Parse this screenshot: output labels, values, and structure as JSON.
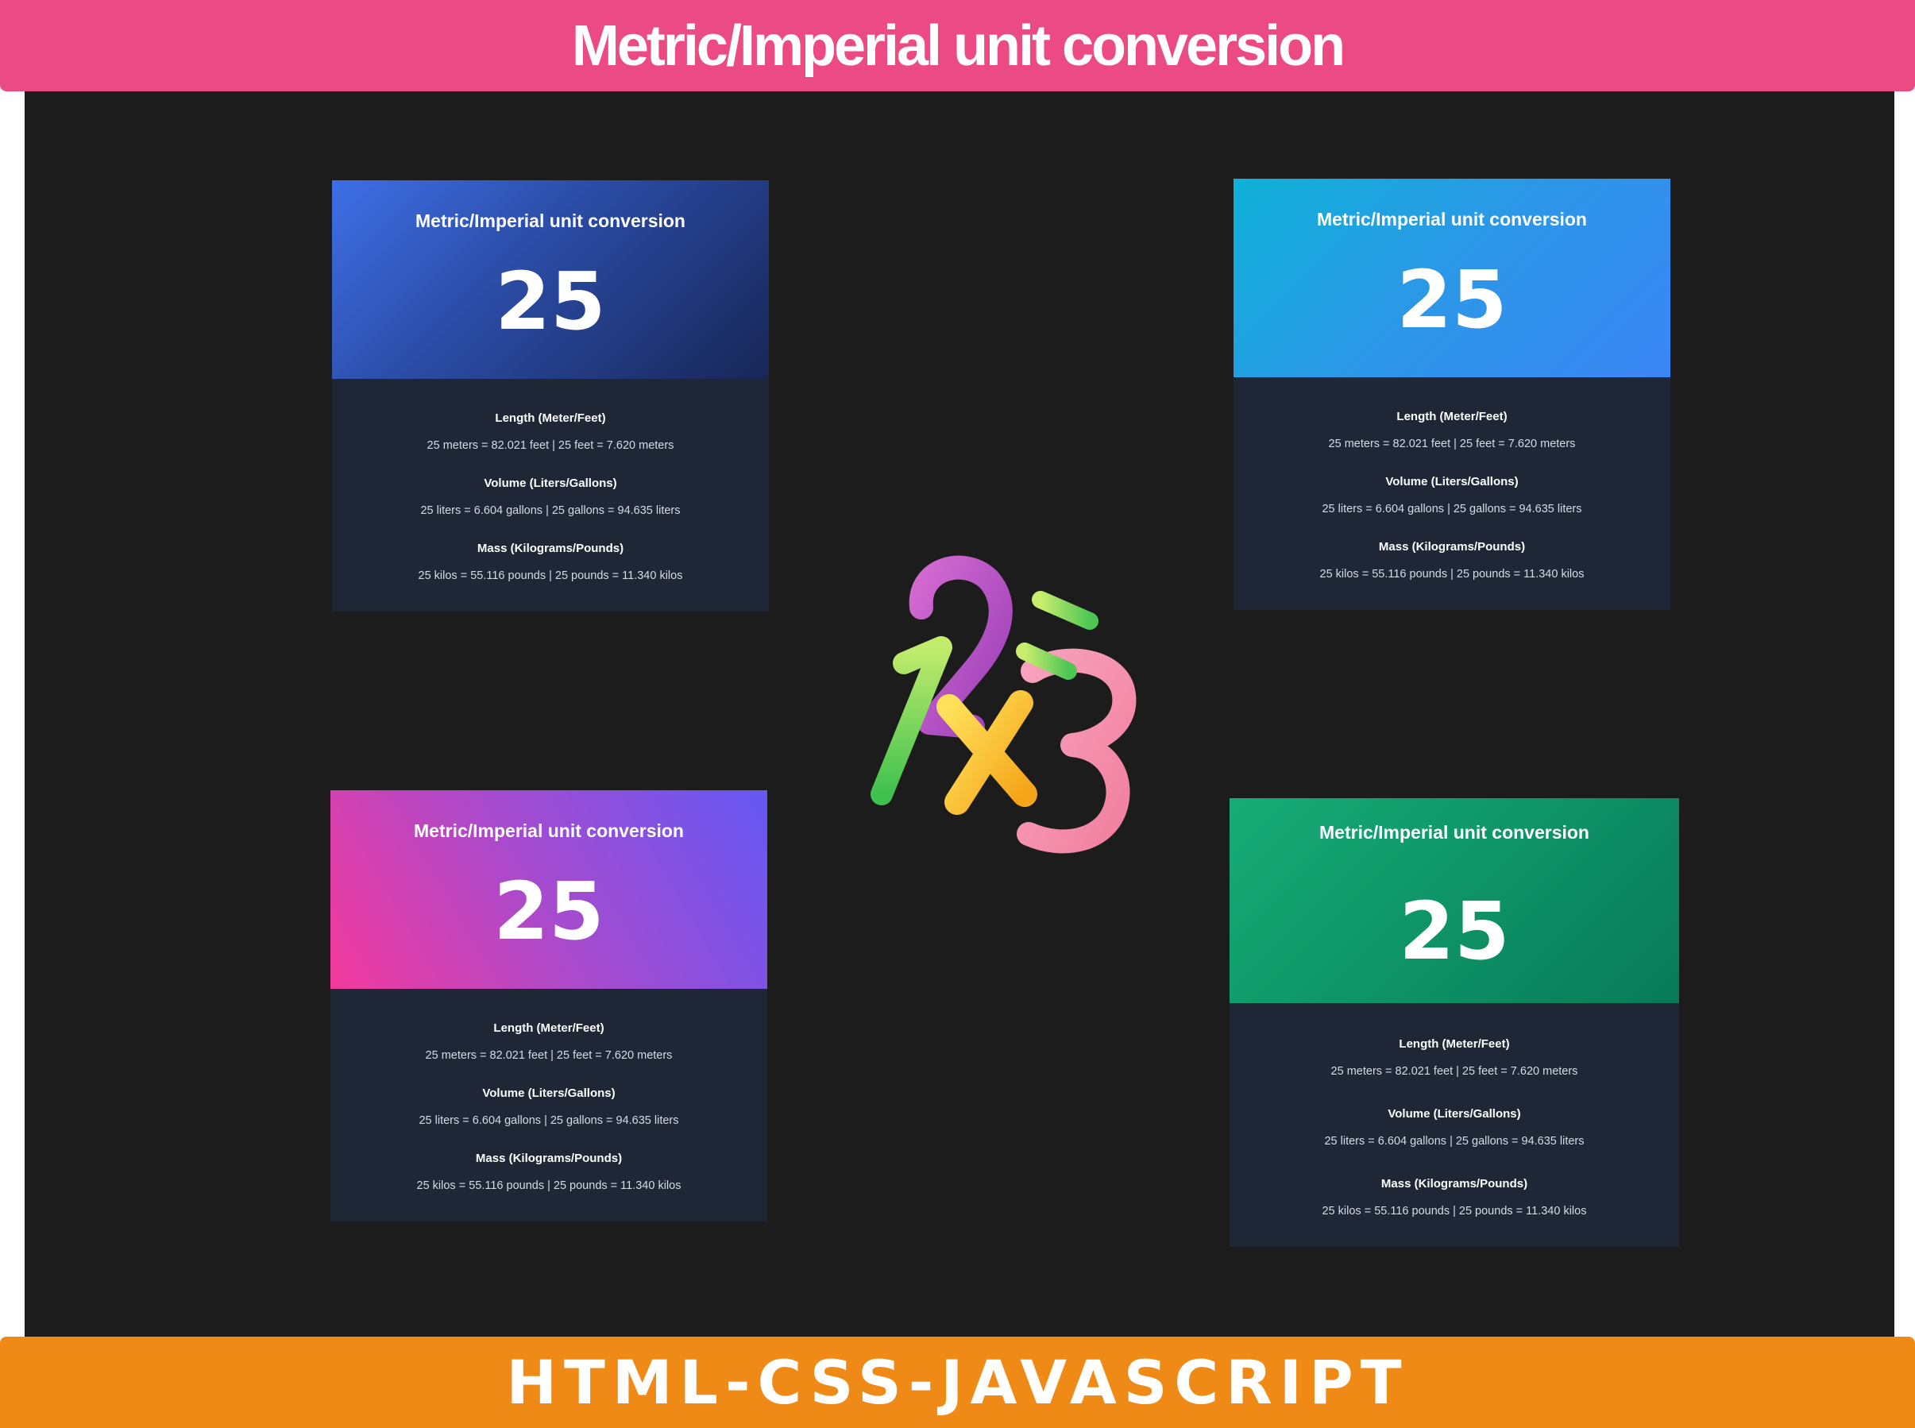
{
  "header": {
    "title": "Metric/Imperial unit conversion"
  },
  "footer": {
    "label": "HTML-CSS-JAVASCRIPT"
  },
  "cards": [
    {
      "title": "Metric/Imperial unit conversion",
      "value": "25",
      "sections": [
        {
          "title": "Length (Meter/Feet)",
          "text": "25 meters = 82.021 feet | 25 feet = 7.620 meters"
        },
        {
          "title": "Volume (Liters/Gallons)",
          "text": "25 liters = 6.604 gallons | 25 gallons = 94.635 liters"
        },
        {
          "title": "Mass (Kilograms/Pounds)",
          "text": "25 kilos = 55.116 pounds | 25 pounds = 11.340 kilos"
        }
      ]
    },
    {
      "title": "Metric/Imperial unit conversion",
      "value": "25",
      "sections": [
        {
          "title": "Length (Meter/Feet)",
          "text": "25 meters = 82.021 feet | 25 feet = 7.620 meters"
        },
        {
          "title": "Volume (Liters/Gallons)",
          "text": "25 liters = 6.604 gallons | 25 gallons = 94.635 liters"
        },
        {
          "title": "Mass (Kilograms/Pounds)",
          "text": "25 kilos = 55.116 pounds | 25 pounds = 11.340 kilos"
        }
      ]
    },
    {
      "title": "Metric/Imperial unit conversion",
      "value": "25",
      "sections": [
        {
          "title": "Length (Meter/Feet)",
          "text": "25 meters = 82.021 feet | 25 feet = 7.620 meters"
        },
        {
          "title": "Volume (Liters/Gallons)",
          "text": "25 liters = 6.604 gallons | 25 gallons = 94.635 liters"
        },
        {
          "title": "Mass (Kilograms/Pounds)",
          "text": "25 kilos = 55.116 pounds | 25 pounds = 11.340 kilos"
        }
      ]
    },
    {
      "title": "Metric/Imperial unit conversion",
      "value": "25",
      "sections": [
        {
          "title": "Length (Meter/Feet)",
          "text": "25 meters = 82.021 feet | 25 feet = 7.620 meters"
        },
        {
          "title": "Volume (Liters/Gallons)",
          "text": "25 liters = 6.604 gallons | 25 gallons = 94.635 liters"
        },
        {
          "title": "Mass (Kilograms/Pounds)",
          "text": "25 kilos = 55.116 pounds | 25 pounds = 11.340 kilos"
        }
      ]
    }
  ],
  "logo": {
    "icon": "numbers-logo-icon",
    "glyphs": [
      "1",
      "2",
      "x",
      "3"
    ]
  },
  "colors": {
    "header_bg": "#ec4a82",
    "footer_bg": "#f08a17",
    "stage_bg": "#1c1c1c",
    "card_body_bg": "#1f2737"
  }
}
